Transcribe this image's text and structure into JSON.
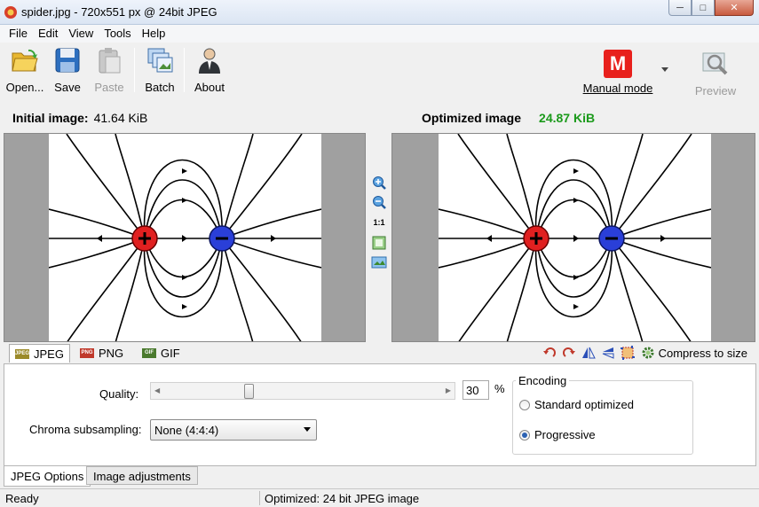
{
  "window": {
    "title": "spider.jpg - 720x551 px @ 24bit JPEG",
    "minimize": "─",
    "maximize": "□",
    "close": "✕"
  },
  "menu": [
    "File",
    "Edit",
    "View",
    "Tools",
    "Help"
  ],
  "toolbar": {
    "open": "Open...",
    "save": "Save",
    "paste": "Paste",
    "batch": "Batch",
    "about": "About",
    "mode_letter": "M",
    "mode": "Manual mode",
    "preview": "Preview"
  },
  "initial": {
    "label": "Initial image:",
    "size": "41.64 KiB"
  },
  "optimized": {
    "label": "Optimized image",
    "size": "24.87 KiB"
  },
  "mid_tools": {
    "zoom_reset": "1:1"
  },
  "formats": {
    "tabs": [
      {
        "label": "JPEG",
        "badge": "JPEG",
        "color": "#9b8a2a"
      },
      {
        "label": "PNG",
        "badge": "PNG",
        "color": "#c0392b"
      },
      {
        "label": "GIF",
        "badge": "GIF",
        "color": "#4a7a2e"
      }
    ],
    "compress": "Compress to size"
  },
  "options": {
    "quality_label": "Quality:",
    "quality_value": "30",
    "quality_unit": "%",
    "quality_fraction": 0.3,
    "chroma_label": "Chroma subsampling:",
    "chroma_value": "None (4:4:4)",
    "encoding_title": "Encoding",
    "encoding_options": [
      "Standard optimized",
      "Progressive"
    ],
    "encoding_selected": "Progressive"
  },
  "bottom_tabs": [
    "JPEG Options",
    "Image adjustments"
  ],
  "status": {
    "left": "Ready",
    "right": "Optimized: 24 bit JPEG image"
  },
  "colors": {
    "positive_charge": "#e02020",
    "negative_charge": "#2a3fd8",
    "optimized_size": "#1b9a1b",
    "mode_badge": "#e8201c"
  }
}
